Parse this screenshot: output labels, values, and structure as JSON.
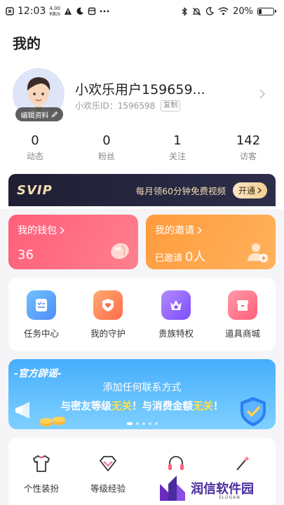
{
  "status_bar": {
    "time": "12:03",
    "speed_value": "4.00",
    "speed_unit": "KB/s",
    "battery": "20%",
    "battery_level": 0.2
  },
  "page": {
    "title": "我的"
  },
  "profile": {
    "edit_label": "编辑资料",
    "username": "小欢乐用户159659...",
    "userid": "小欢乐ID：1596598",
    "copy_label": "复制"
  },
  "stats": [
    {
      "value": "0",
      "label": "动态"
    },
    {
      "value": "0",
      "label": "粉丝"
    },
    {
      "value": "1",
      "label": "关注"
    },
    {
      "value": "142",
      "label": "访客"
    }
  ],
  "svip": {
    "logo": "SVIP",
    "promo": "每月领60分钟免费视频",
    "button": "开通"
  },
  "wallet": {
    "title": "我的钱包",
    "amount": "36"
  },
  "invite": {
    "title": "我的邀请",
    "prefix": "已邀请",
    "count": "0人"
  },
  "services": [
    {
      "label": "任务中心",
      "icon": "task-list-icon",
      "color": "#5aa9f6"
    },
    {
      "label": "我的守护",
      "icon": "shield-heart-icon",
      "color": "#ff7a4d"
    },
    {
      "label": "贵族特权",
      "icon": "crown-icon",
      "color": "#8b5cf6"
    },
    {
      "label": "道具商城",
      "icon": "store-box-icon",
      "color": "#ff6b81"
    }
  ],
  "banner": {
    "tag": "-官方辟谣-",
    "line1": "添加任何联系方式",
    "line2_a": "与密友等级",
    "line2_b": "无关",
    "line2_c": "！与消费金额",
    "line2_d": "无关",
    "line2_e": "！"
  },
  "bottom_items": [
    {
      "label": "个性装扮",
      "icon": "tshirt-icon"
    },
    {
      "label": "等级经验",
      "icon": "diamond-icon"
    },
    {
      "label": "",
      "icon": "headset-icon"
    },
    {
      "label": "",
      "icon": "magic-wand-icon"
    }
  ],
  "watermark": {
    "text": "润信软件园",
    "slogan": "SLOGAN"
  }
}
